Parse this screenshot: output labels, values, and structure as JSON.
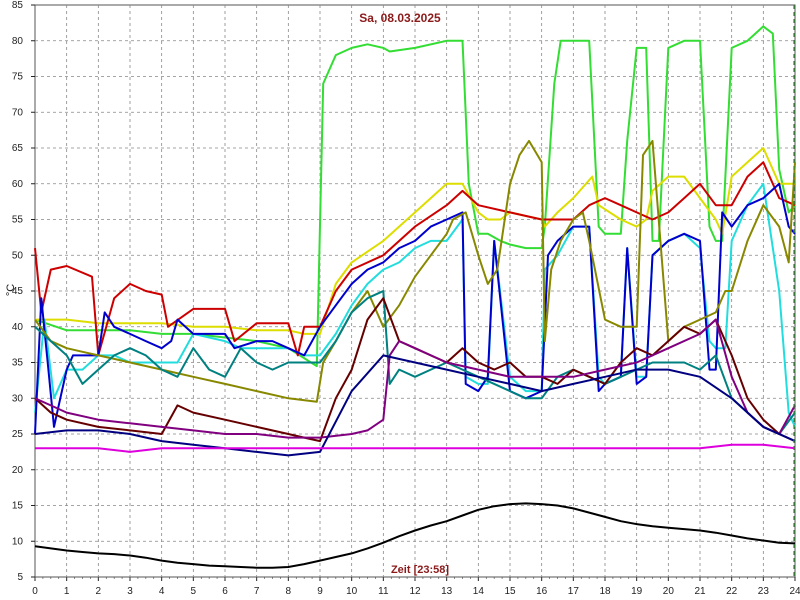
{
  "chart_data": {
    "type": "line",
    "title": "Sa, 08.03.2025",
    "xlabel": "Zeit [23:58]",
    "ylabel": "°C",
    "xlim": [
      0,
      24
    ],
    "ylim": [
      5,
      85
    ],
    "x_ticks": [
      0,
      1,
      2,
      3,
      4,
      5,
      6,
      7,
      8,
      9,
      10,
      11,
      12,
      13,
      14,
      15,
      16,
      17,
      18,
      19,
      20,
      21,
      22,
      23,
      24
    ],
    "y_ticks": [
      5,
      10,
      15,
      20,
      25,
      30,
      35,
      40,
      45,
      50,
      55,
      60,
      65,
      70,
      75,
      80,
      85
    ],
    "grid": true,
    "series": [
      {
        "color": "#33dd33",
        "x": [
          0,
          1,
          2,
          3,
          4,
          5,
          6,
          7,
          8,
          8.9,
          9.1,
          9.5,
          10,
          10.5,
          11,
          11.2,
          12,
          13,
          13.5,
          13.7,
          14,
          14.3,
          14.7,
          15,
          15.5,
          16,
          16.1,
          16.4,
          16.6,
          17,
          17.5,
          17.8,
          18,
          18.5,
          18.7,
          19,
          19.3,
          19.5,
          19.7,
          20,
          20.5,
          21,
          21.3,
          21.5,
          21.7,
          22,
          22.5,
          23,
          23.3,
          23.5,
          23.8,
          24
        ],
        "values": [
          41,
          39.5,
          39.5,
          39.5,
          39,
          39,
          38.5,
          38,
          37,
          34.5,
          74,
          78,
          79,
          79.5,
          79,
          78.5,
          79,
          80,
          80,
          60,
          53,
          53,
          52,
          51.5,
          51,
          51,
          54,
          74,
          80,
          80,
          80,
          54,
          53,
          53,
          66,
          79,
          79,
          52,
          52,
          79,
          80,
          80,
          54,
          52,
          52,
          79,
          80,
          82,
          81,
          62,
          56,
          57
        ]
      },
      {
        "color": "#dddd00",
        "x": [
          0,
          0.3,
          1,
          2,
          3,
          4,
          5,
          6,
          7,
          8,
          8.5,
          9,
          9.5,
          10,
          11,
          12,
          12.5,
          13,
          13.5,
          14,
          14.3,
          14.7,
          15,
          16,
          16.1,
          16.5,
          17,
          17.6,
          17.8,
          18.5,
          19,
          19.3,
          19.5,
          20,
          20.5,
          21,
          21.5,
          21.7,
          22,
          22.5,
          23,
          23.5,
          23.8,
          24
        ],
        "values": [
          41,
          41,
          41,
          40.5,
          40.5,
          40.5,
          40,
          40,
          39.5,
          39.5,
          39,
          39,
          46,
          49,
          52,
          56,
          58,
          60,
          60,
          56,
          55,
          55,
          56,
          55,
          54,
          56,
          58,
          61,
          57,
          55,
          54,
          55,
          59,
          61,
          61,
          58,
          55,
          53,
          61,
          63,
          65,
          60,
          60,
          60
        ],
        "labels": []
      },
      {
        "color": "#cc0000",
        "x": [
          0,
          0.2,
          0.5,
          1,
          1.8,
          2,
          2.5,
          3,
          3.5,
          4,
          4.2,
          5,
          6,
          6.3,
          7,
          8,
          8.3,
          8.5,
          9,
          9.5,
          10,
          11,
          12,
          13,
          13.5,
          14,
          15,
          16,
          16.5,
          17,
          17.5,
          18,
          18.5,
          19,
          19.5,
          20,
          20.5,
          21,
          21.5,
          22,
          22.5,
          23,
          23.5,
          24
        ],
        "values": [
          51,
          42,
          48,
          48.5,
          47,
          36,
          44,
          46,
          45,
          44.5,
          40,
          42.5,
          42.5,
          38,
          40.5,
          40.5,
          36,
          40,
          40,
          45,
          48,
          50,
          54,
          57,
          59,
          57,
          56,
          55,
          55,
          55,
          57,
          58,
          57,
          56,
          55,
          56,
          58,
          60,
          57,
          57,
          61,
          63,
          58,
          57
        ]
      },
      {
        "color": "#22dddd",
        "x": [
          0,
          0.3,
          0.6,
          1,
          1.5,
          2,
          2.5,
          3,
          4,
          4.5,
          5,
          6,
          6.5,
          7,
          8,
          8.5,
          9,
          9.5,
          10,
          10.5,
          11,
          11.5,
          12,
          12.5,
          13,
          13.5,
          13.6,
          14,
          14.3,
          14.5,
          15,
          15.5,
          16,
          16.1,
          16.5,
          17,
          17.5,
          17.8,
          18,
          18.5,
          18.7,
          19,
          19.3,
          19.5,
          20,
          20.5,
          21,
          21.3,
          21.5,
          21.8,
          22,
          22.5,
          23,
          23.5,
          23.8,
          24
        ],
        "values": [
          28,
          41,
          30,
          34,
          34,
          36,
          36,
          35,
          35,
          35,
          39,
          38,
          37,
          37,
          37,
          36,
          36,
          39,
          43,
          46,
          48,
          49,
          51,
          52,
          52,
          55,
          33,
          32,
          32,
          52,
          33,
          31,
          31,
          48,
          50,
          54,
          54,
          33,
          32,
          33,
          51,
          33,
          33,
          50,
          52,
          53,
          51,
          38,
          37,
          37,
          52,
          57,
          60,
          45,
          28,
          26
        ]
      },
      {
        "color": "#0000cc",
        "x": [
          0,
          0.2,
          0.4,
          0.6,
          0.8,
          1,
          1.2,
          1.5,
          2,
          2.2,
          2.5,
          3,
          3.5,
          4,
          4.3,
          4.5,
          5,
          6,
          6.3,
          7,
          7.5,
          8,
          8.5,
          9,
          9.5,
          10,
          10.5,
          11,
          11.5,
          12,
          12.5,
          13,
          13.5,
          13.6,
          14,
          14.3,
          14.5,
          15,
          15.5,
          16,
          16.2,
          16.5,
          17,
          17.5,
          17.8,
          18,
          18.5,
          18.7,
          19,
          19.3,
          19.5,
          20,
          20.5,
          21,
          21.3,
          21.5,
          21.7,
          22,
          22.5,
          23,
          23.5,
          23.8,
          24
        ],
        "values": [
          25,
          44,
          35,
          26,
          30,
          34,
          36,
          36,
          36,
          42,
          40,
          39,
          38,
          37,
          38,
          41,
          39,
          39,
          37,
          38,
          38,
          37,
          36,
          40,
          43,
          46,
          48,
          49,
          51,
          52,
          54,
          55,
          56,
          32,
          31,
          33,
          52,
          31,
          30,
          31,
          50,
          52,
          54,
          54,
          31,
          32,
          33,
          51,
          32,
          33,
          50,
          52,
          53,
          52,
          34,
          34,
          56,
          54,
          57,
          58,
          60,
          54,
          53
        ]
      },
      {
        "color": "#888800",
        "x": [
          0,
          0.5,
          1,
          1.5,
          2,
          2.5,
          3,
          4,
          5,
          6,
          7,
          8,
          8.9,
          9.1,
          9.5,
          10,
          10.5,
          11,
          11.5,
          12,
          12.5,
          13,
          13.2,
          13.6,
          14,
          14.3,
          14.6,
          15,
          15.3,
          15.6,
          16,
          16.1,
          16.3,
          16.6,
          17,
          17.3,
          17.5,
          18,
          18.5,
          19,
          19.2,
          19.5,
          20,
          20.5,
          21,
          21.5,
          21.8,
          22,
          22.5,
          23,
          23.5,
          23.8,
          24
        ],
        "values": [
          41,
          38,
          37,
          36.5,
          36,
          35.5,
          35,
          34,
          33,
          32,
          31,
          30,
          29.5,
          35,
          38,
          42,
          45,
          40,
          43,
          47,
          50,
          53,
          55,
          56,
          50,
          46,
          48,
          60,
          64,
          66,
          63,
          38,
          48,
          52,
          55,
          56,
          52,
          41,
          40,
          40,
          64,
          66,
          38,
          40,
          41,
          42,
          45,
          45,
          52,
          57,
          54,
          49,
          63
        ]
      },
      {
        "color": "#008080",
        "x": [
          0,
          0.5,
          1,
          1.5,
          2,
          2.5,
          3,
          3.5,
          4,
          4.5,
          5,
          5.5,
          6,
          6.5,
          7,
          7.5,
          8,
          8.5,
          9,
          9.5,
          10,
          10.5,
          11,
          11.2,
          11.5,
          12,
          12.5,
          13,
          13.5,
          14,
          14.5,
          15,
          15.5,
          16,
          16.5,
          17,
          17.5,
          18,
          18.5,
          19,
          19.5,
          20,
          20.5,
          21,
          21.5,
          22,
          22.5,
          23,
          23.5,
          24
        ],
        "values": [
          40,
          38,
          36,
          32,
          34,
          36,
          37,
          36,
          34,
          33,
          37,
          34,
          33,
          37,
          35,
          34,
          35,
          35,
          35,
          38,
          42,
          44,
          45,
          32,
          34,
          33,
          34,
          35,
          34,
          33,
          32,
          31,
          30,
          30,
          33,
          34,
          33,
          32,
          33,
          34,
          35,
          35,
          35,
          34,
          36,
          30,
          28,
          26,
          25,
          28
        ]
      },
      {
        "color": "#660000",
        "x": [
          0,
          0.5,
          1,
          2,
          3,
          4,
          4.5,
          5,
          6,
          7,
          8,
          8.5,
          9,
          9.5,
          10,
          10.5,
          11,
          11.5,
          12,
          12.5,
          13,
          13.5,
          14,
          14.5,
          15,
          15.5,
          16,
          16.5,
          17,
          17.5,
          18,
          18.5,
          19,
          19.5,
          20,
          20.5,
          21,
          21.5,
          22,
          22.5,
          23,
          23.5,
          24
        ],
        "values": [
          30,
          28,
          27,
          26,
          25.5,
          25,
          29,
          28,
          27,
          26,
          25,
          24.5,
          24,
          30,
          34,
          41,
          44,
          38,
          37,
          36,
          35,
          37,
          35,
          34,
          35,
          33,
          33,
          32,
          34,
          33,
          32,
          35,
          37,
          36,
          38,
          40,
          39,
          41,
          36,
          30,
          27,
          25,
          24
        ]
      },
      {
        "color": "#800080",
        "x": [
          0,
          0.5,
          1,
          2,
          3,
          4,
          5,
          6,
          7,
          8,
          9,
          10,
          10.5,
          11,
          11.2,
          11.5,
          12,
          13,
          14,
          15,
          16,
          17,
          18,
          19,
          20,
          21,
          21.5,
          22,
          22.5,
          23,
          23.5,
          24
        ],
        "values": [
          30,
          29,
          28,
          27,
          26.5,
          26,
          25.5,
          25,
          25,
          24.5,
          24.5,
          25,
          25.5,
          27,
          36,
          38,
          37,
          35,
          34,
          33,
          33,
          33,
          34,
          35,
          37,
          39,
          41,
          33,
          28,
          26,
          25,
          29
        ]
      },
      {
        "color": "#000080",
        "x": [
          0,
          1,
          2,
          3,
          4,
          5,
          6,
          7,
          8,
          9,
          10,
          11,
          12,
          13,
          14,
          15,
          16,
          17,
          18,
          19,
          20,
          21,
          22,
          23,
          24
        ],
        "values": [
          25,
          25.5,
          25.5,
          25,
          24,
          23.5,
          23,
          22.5,
          22,
          22.5,
          31,
          36,
          35,
          34,
          33,
          32,
          31,
          32,
          33,
          34,
          34,
          33,
          30,
          26,
          24
        ]
      },
      {
        "color": "#dd00dd",
        "x": [
          0,
          1,
          2,
          3,
          4,
          5,
          6,
          7,
          8,
          9,
          10,
          11,
          12,
          13,
          14,
          15,
          16,
          17,
          18,
          19,
          20,
          21,
          22,
          23,
          24
        ],
        "values": [
          23,
          23,
          23,
          22.5,
          23,
          23,
          23,
          23,
          23,
          23,
          23,
          23,
          23,
          23,
          23,
          23,
          23,
          23,
          23,
          23,
          23,
          23,
          23.5,
          23.5,
          23
        ]
      },
      {
        "color": "#000000",
        "x": [
          0,
          0.5,
          1,
          1.5,
          2,
          2.5,
          3,
          3.5,
          4,
          4.5,
          5,
          5.5,
          6,
          6.5,
          7,
          7.5,
          8,
          8.5,
          9,
          9.5,
          10,
          10.5,
          11,
          11.5,
          12,
          12.5,
          13,
          13.5,
          14,
          14.5,
          15,
          15.5,
          16,
          16.5,
          17,
          17.5,
          18,
          18.5,
          19,
          19.5,
          20,
          20.5,
          21,
          21.5,
          22,
          22.5,
          23,
          23.5,
          24
        ],
        "values": [
          9.3,
          9,
          8.7,
          8.5,
          8.3,
          8.2,
          8,
          7.7,
          7.3,
          7,
          6.8,
          6.6,
          6.5,
          6.4,
          6.3,
          6.3,
          6.4,
          6.8,
          7.3,
          7.8,
          8.3,
          9,
          9.8,
          10.7,
          11.5,
          12.2,
          12.8,
          13.6,
          14.4,
          14.9,
          15.2,
          15.3,
          15.2,
          15,
          14.6,
          14,
          13.4,
          12.8,
          12.4,
          12.1,
          11.9,
          11.7,
          11.5,
          11.2,
          10.8,
          10.4,
          10.1,
          9.8,
          9.7
        ]
      }
    ]
  }
}
